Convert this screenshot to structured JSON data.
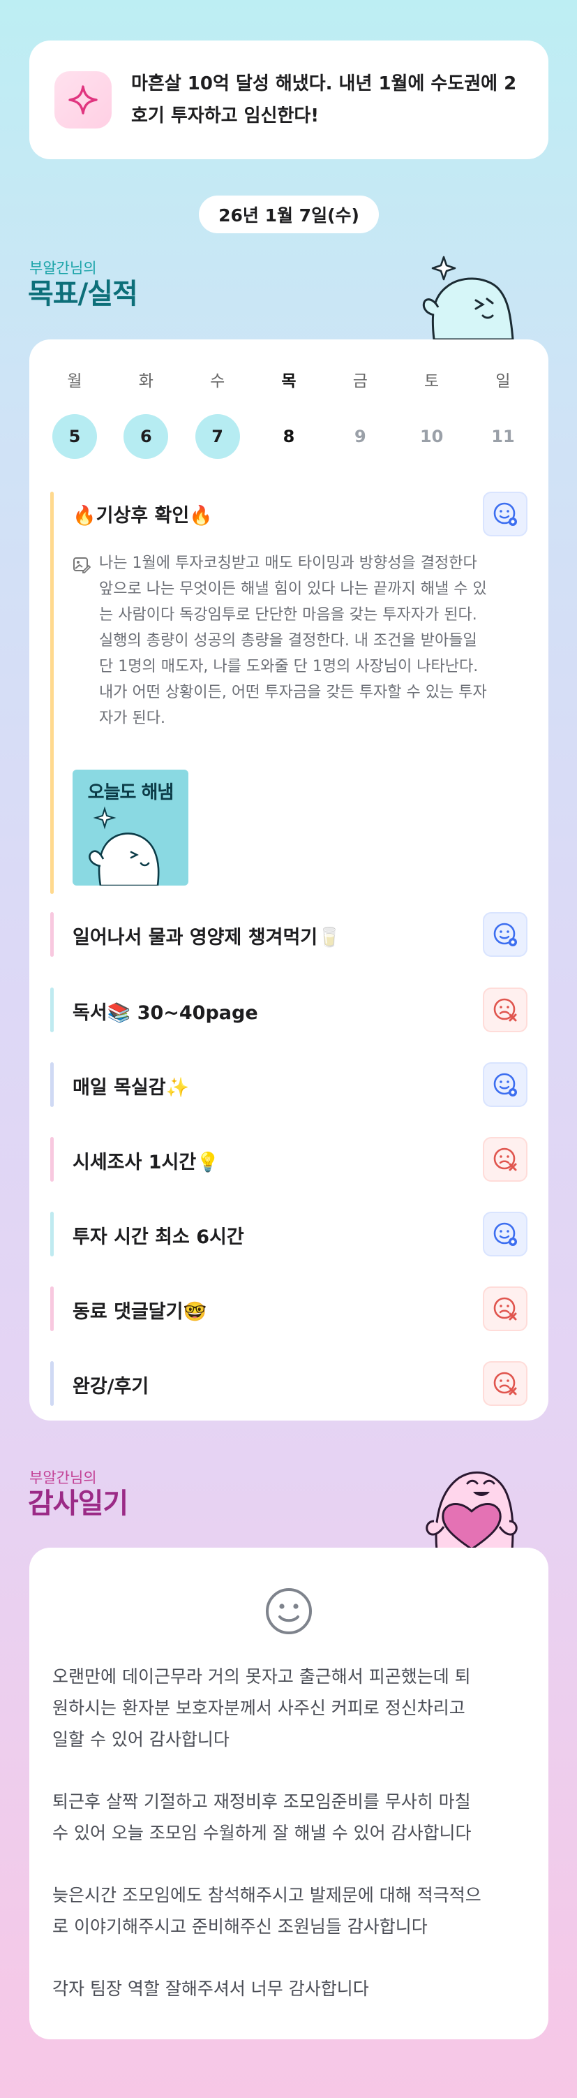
{
  "goal_banner": {
    "text_line1": "마흔살 10억 달성 해냈다. 내년 1월에 수도권에 2",
    "text_line2": "호기 투자하고 임신한다!",
    "icon": "sparkle-icon",
    "accent": "#e0357f"
  },
  "date": {
    "label": "26년 1월 7일(수)"
  },
  "goals_section": {
    "subtitle": "부알간님의",
    "title": "목표/실적",
    "title_color": "#0d6f79"
  },
  "week": [
    {
      "dow": "월",
      "num": "5",
      "state": "done"
    },
    {
      "dow": "화",
      "num": "6",
      "state": "done"
    },
    {
      "dow": "수",
      "num": "7",
      "state": "done"
    },
    {
      "dow": "목",
      "num": "8",
      "state": "today"
    },
    {
      "dow": "금",
      "num": "9",
      "state": "future"
    },
    {
      "dow": "토",
      "num": "10",
      "state": "future"
    },
    {
      "dow": "일",
      "num": "11",
      "state": "future"
    }
  ],
  "tasks": [
    {
      "label": "🔥기상후 확인🔥",
      "status": "ok",
      "color": "#ffd98e"
    },
    {
      "label": "일어나서 물과 영양제 챙겨먹기🥛",
      "status": "ok",
      "color": "#f8c8df"
    },
    {
      "label": "독서📚 30~40page",
      "status": "ng",
      "color": "#bfeaf0"
    },
    {
      "label": "매일 목실감✨",
      "status": "ok",
      "color": "#cfd9f4"
    },
    {
      "label": "시세조사 1시간💡",
      "status": "ng",
      "color": "#f8c8df"
    },
    {
      "label": "투자 시간 최소 6시간",
      "status": "ok",
      "color": "#bfeaf0"
    },
    {
      "label": "동료 댓글달기🤓",
      "status": "ng",
      "color": "#f8c8df"
    },
    {
      "label": "완강/후기",
      "status": "ng",
      "color": "#cfd9f4"
    }
  ],
  "memo": {
    "lines": [
      "나는 1월에 투자코칭받고 매도 타이밍과 방향성을 결정한다",
      "앞으로 나는 무엇이든 해낼 힘이 있다 나는 끝까지 해낼 수 있",
      "는 사람이다 독강임투로 단단한 마음을 갖는 투자자가 된다.",
      "실행의 총량이 성공의 총량을 결정한다. 내 조건을 받아들일",
      "단 1명의 매도자, 나를 도와줄 단 1명의 사장님이 나타난다.",
      "내가 어떤 상황이든, 어떤 투자금을 갖든 투자할 수 있는 투자",
      "자가 된다."
    ],
    "sticker_text": "오늘도 해냄"
  },
  "gratitude_section": {
    "subtitle": "부알간님의",
    "title": "감사일기",
    "title_color": "#9b2a86",
    "subtitle_color": "#c23f94"
  },
  "diary": {
    "face_icon": "smile-icon",
    "paragraphs": [
      [
        "오랜만에 데이근무라 거의 못자고 출근해서 피곤했는데 퇴",
        "원하시는 환자분 보호자분께서 사주신 커피로 정신차리고",
        "일할 수 있어 감사합니다"
      ],
      [
        "퇴근후 살짝 기절하고 재정비후 조모임준비를 무사히 마칠",
        "수 있어 오늘 조모임 수월하게 잘 해낼 수 있어 감사합니다"
      ],
      [
        "늦은시간 조모임에도 참석해주시고 발제문에 대해 적극적으",
        "로 이야기해주시고 준비해주신 조원님들 감사합니다"
      ],
      [
        "각자 팀장 역할 잘해주셔서 너무 감사합니다"
      ]
    ]
  }
}
